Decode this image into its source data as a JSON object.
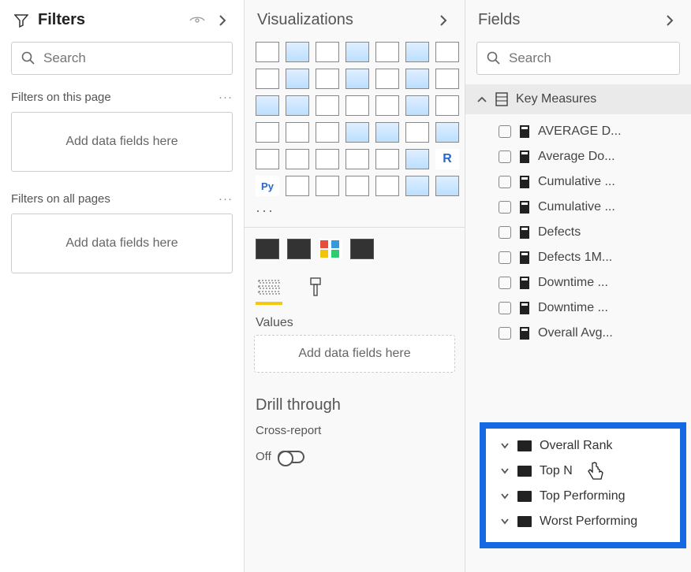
{
  "filters": {
    "title": "Filters",
    "search_placeholder": "Search",
    "page_section": "Filters on this page",
    "all_section": "Filters on all pages",
    "dropzone_text": "Add data fields here"
  },
  "viz": {
    "title": "Visualizations",
    "values_label": "Values",
    "values_placeholder": "Add data fields here",
    "drill_title": "Drill through",
    "cross_report_label": "Cross-report",
    "toggle_state": "Off"
  },
  "fields": {
    "title": "Fields",
    "search_placeholder": "Search",
    "table_name": "Key Measures",
    "measures": [
      "AVERAGE D...",
      "Average Do...",
      "Cumulative ...",
      "Cumulative ...",
      "Defects",
      "Defects 1M...",
      "Downtime ...",
      "Downtime ...",
      "Overall Avg..."
    ],
    "folders": [
      "Overall Rank",
      "Top N",
      "Top Performing",
      "Worst Performing"
    ]
  }
}
